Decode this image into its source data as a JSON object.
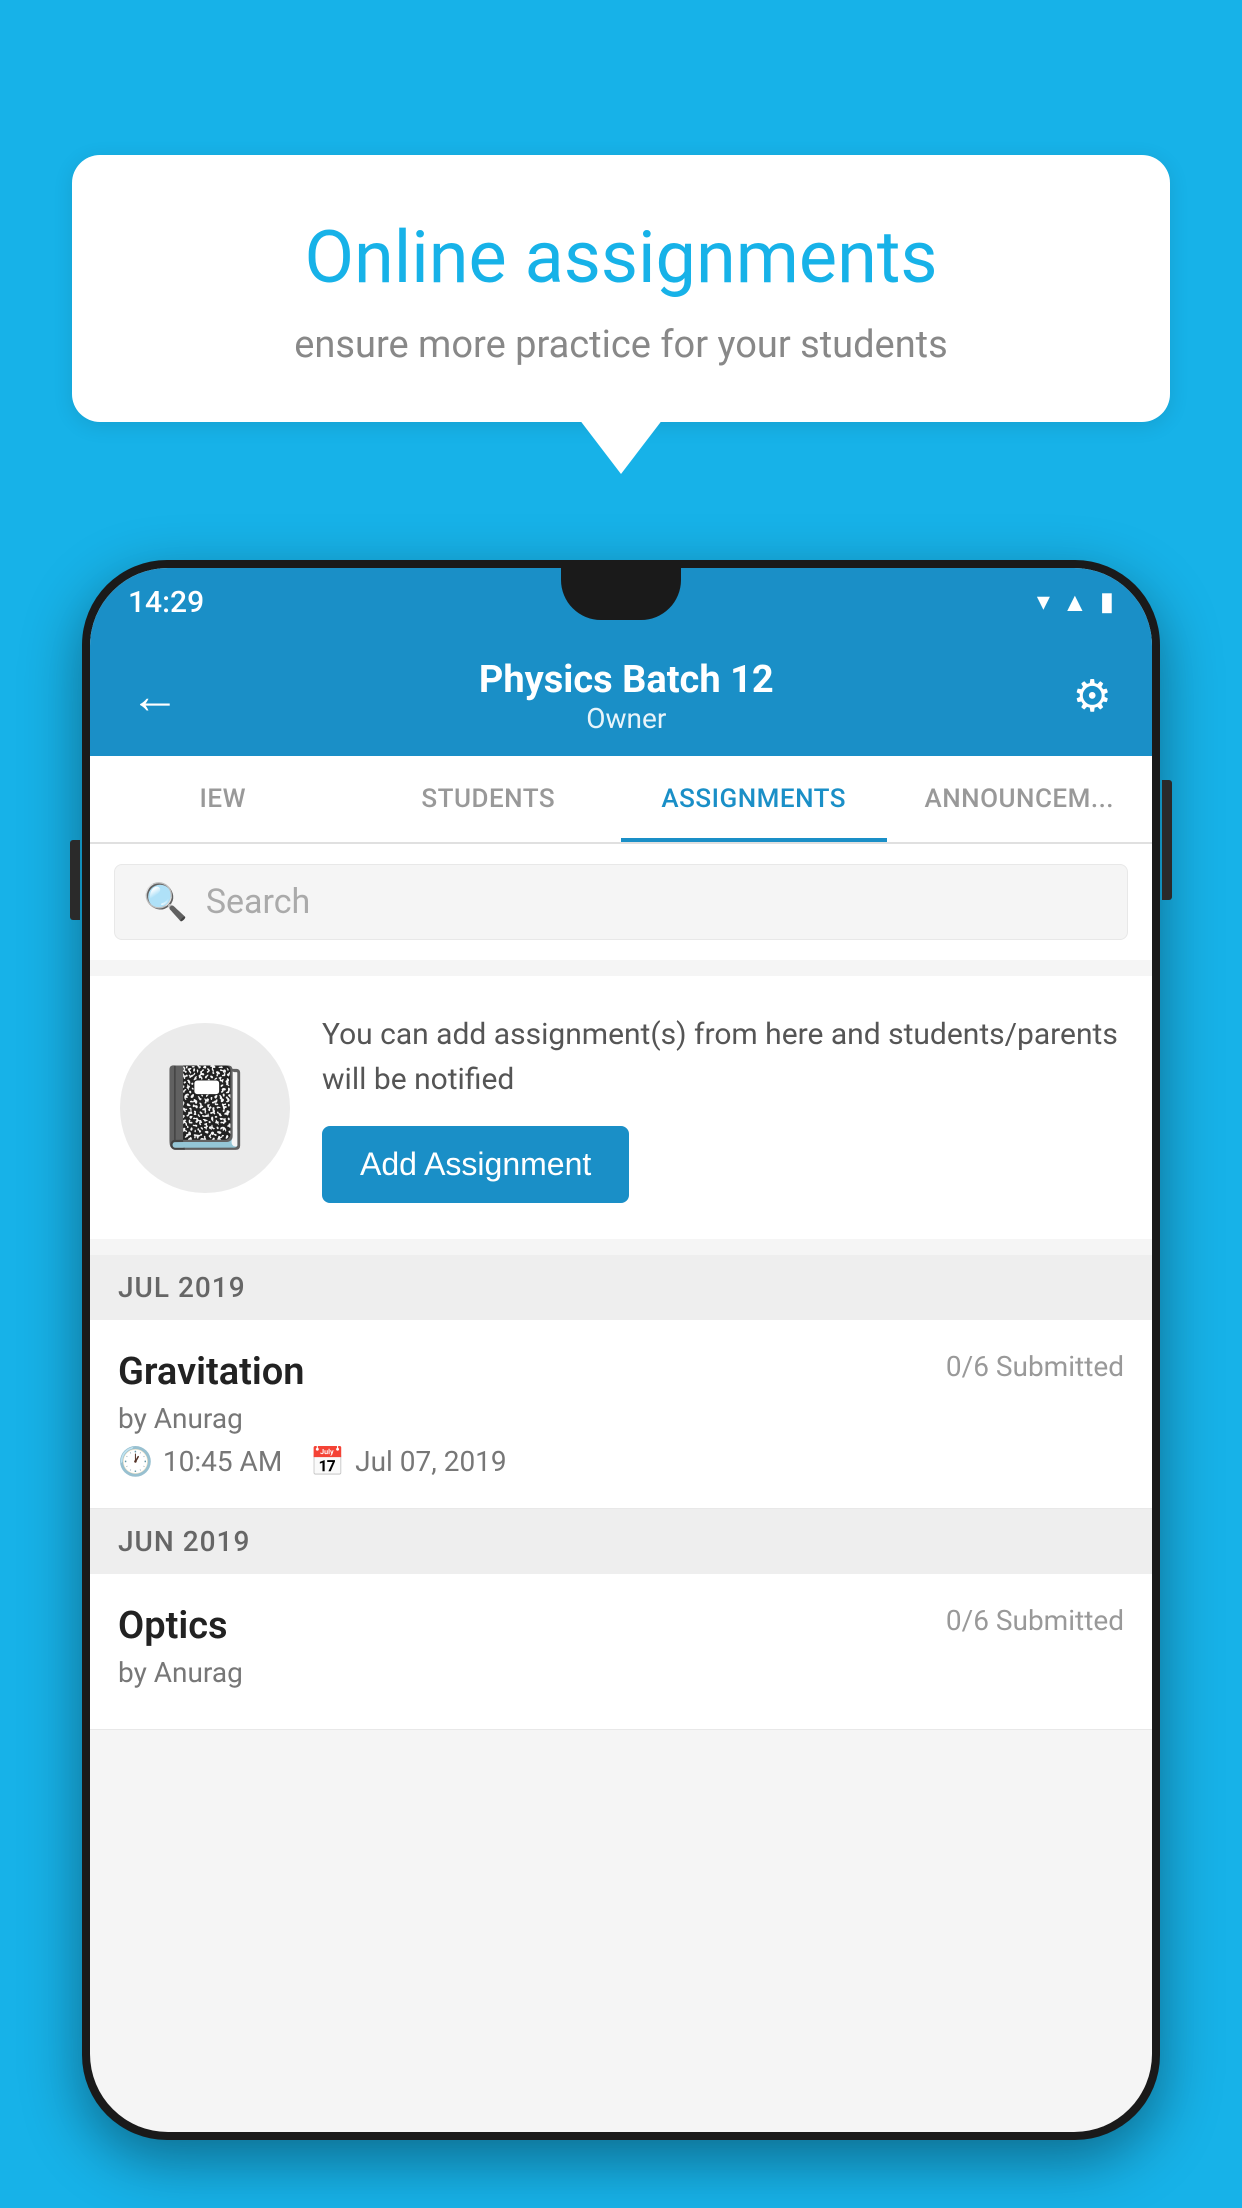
{
  "background_color": "#17b2e8",
  "speech_bubble": {
    "title": "Online assignments",
    "subtitle": "ensure more practice for your students"
  },
  "phone": {
    "status_bar": {
      "time": "14:29",
      "icons": [
        "wifi",
        "signal",
        "battery"
      ]
    },
    "app_bar": {
      "title": "Physics Batch 12",
      "subtitle": "Owner",
      "back_label": "←",
      "settings_label": "⚙"
    },
    "tabs": [
      {
        "label": "IEW",
        "active": false
      },
      {
        "label": "STUDENTS",
        "active": false
      },
      {
        "label": "ASSIGNMENTS",
        "active": true
      },
      {
        "label": "ANNOUNCEM...",
        "active": false
      }
    ],
    "search": {
      "placeholder": "Search"
    },
    "add_assignment_section": {
      "info_text": "You can add assignment(s) from here and students/parents will be notified",
      "button_label": "Add Assignment"
    },
    "months": [
      {
        "label": "JUL 2019",
        "assignments": [
          {
            "name": "Gravitation",
            "submitted": "0/6 Submitted",
            "by": "by Anurag",
            "time": "10:45 AM",
            "date": "Jul 07, 2019"
          }
        ]
      },
      {
        "label": "JUN 2019",
        "assignments": [
          {
            "name": "Optics",
            "submitted": "0/6 Submitted",
            "by": "by Anurag",
            "time": "",
            "date": ""
          }
        ]
      }
    ]
  }
}
